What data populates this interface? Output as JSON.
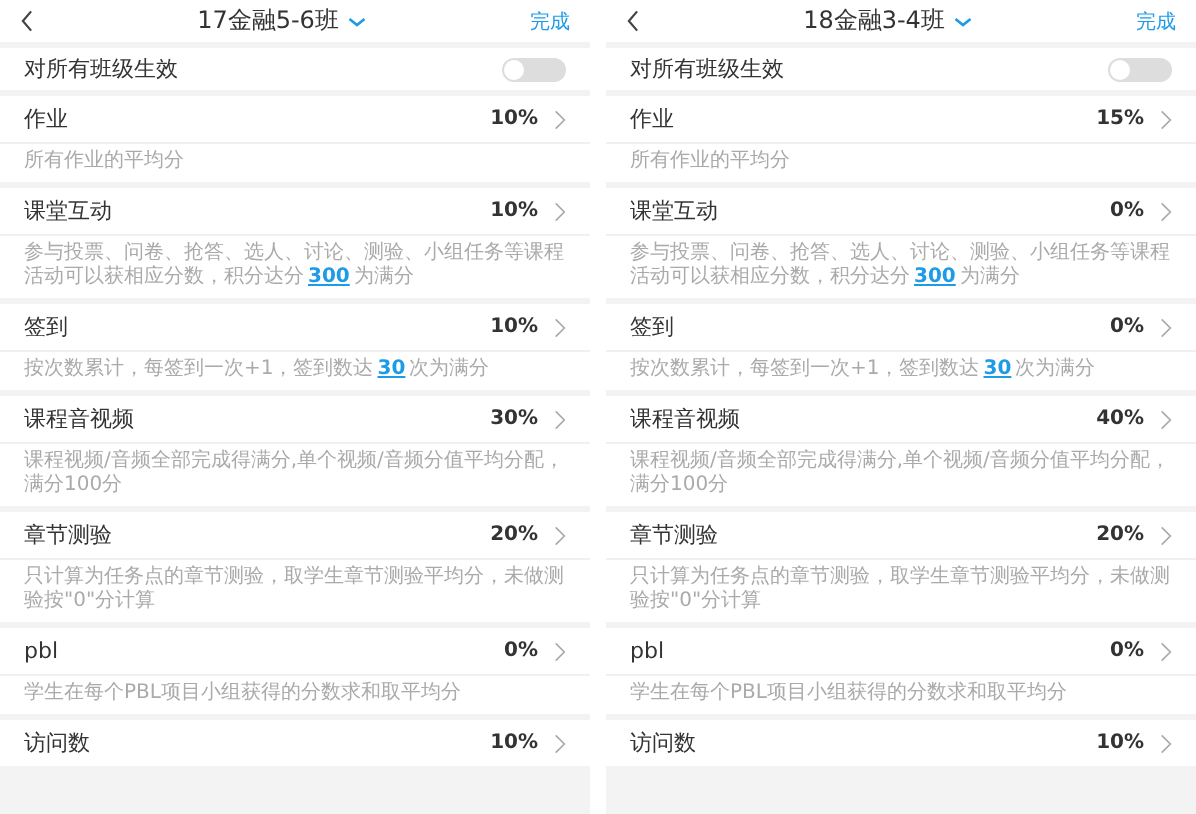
{
  "panels": [
    {
      "title": "17金融5-6班",
      "done": "完成",
      "apply_all": {
        "label": "对所有班级生效",
        "on": false
      },
      "items": [
        {
          "name": "作业",
          "percent": "10%",
          "desc": [
            {
              "kind": "text",
              "text": "所有作业的平均分"
            }
          ]
        },
        {
          "name": "课堂互动",
          "percent": "10%",
          "desc": [
            {
              "kind": "text",
              "text": "参与投票、问卷、抢答、选人、讨论、测验、小组任务等课程活动可以获相应分数，积分达分"
            },
            {
              "kind": "link",
              "text": "300"
            },
            {
              "kind": "text",
              "text": "为满分"
            }
          ]
        },
        {
          "name": "签到",
          "percent": "10%",
          "desc": [
            {
              "kind": "text",
              "text": "按次数累计，每签到一次+1，签到数达"
            },
            {
              "kind": "link",
              "text": "30"
            },
            {
              "kind": "text",
              "text": "次为满分"
            }
          ]
        },
        {
          "name": "课程音视频",
          "percent": "30%",
          "desc": [
            {
              "kind": "text",
              "text": "课程视频/音频全部完成得满分,单个视频/音频分值平均分配，满分100分"
            }
          ]
        },
        {
          "name": "章节测验",
          "percent": "20%",
          "desc": [
            {
              "kind": "text",
              "text": "只计算为任务点的章节测验，取学生章节测验平均分，未做测验按\"0\"分计算"
            }
          ]
        },
        {
          "name": "pbl",
          "percent": "0%",
          "desc": [
            {
              "kind": "text",
              "text": "学生在每个PBL项目小组获得的分数求和取平均分"
            }
          ]
        },
        {
          "name": "访问数",
          "percent": "10%"
        }
      ]
    },
    {
      "title": "18金融3-4班",
      "done": "完成",
      "apply_all": {
        "label": "对所有班级生效",
        "on": false
      },
      "items": [
        {
          "name": "作业",
          "percent": "15%",
          "desc": [
            {
              "kind": "text",
              "text": "所有作业的平均分"
            }
          ]
        },
        {
          "name": "课堂互动",
          "percent": "0%",
          "desc": [
            {
              "kind": "text",
              "text": "参与投票、问卷、抢答、选人、讨论、测验、小组任务等课程活动可以获相应分数，积分达分"
            },
            {
              "kind": "link",
              "text": "300"
            },
            {
              "kind": "text",
              "text": "为满分"
            }
          ]
        },
        {
          "name": "签到",
          "percent": "0%",
          "desc": [
            {
              "kind": "text",
              "text": "按次数累计，每签到一次+1，签到数达"
            },
            {
              "kind": "link",
              "text": "30"
            },
            {
              "kind": "text",
              "text": "次为满分"
            }
          ]
        },
        {
          "name": "课程音视频",
          "percent": "40%",
          "desc": [
            {
              "kind": "text",
              "text": "课程视频/音频全部完成得满分,单个视频/音频分值平均分配，满分100分"
            }
          ]
        },
        {
          "name": "章节测验",
          "percent": "20%",
          "desc": [
            {
              "kind": "text",
              "text": "只计算为任务点的章节测验，取学生章节测验平均分，未做测验按\"0\"分计算"
            }
          ]
        },
        {
          "name": "pbl",
          "percent": "0%",
          "desc": [
            {
              "kind": "text",
              "text": "学生在每个PBL项目小组获得的分数求和取平均分"
            }
          ]
        },
        {
          "name": "访问数",
          "percent": "10%"
        }
      ]
    }
  ]
}
